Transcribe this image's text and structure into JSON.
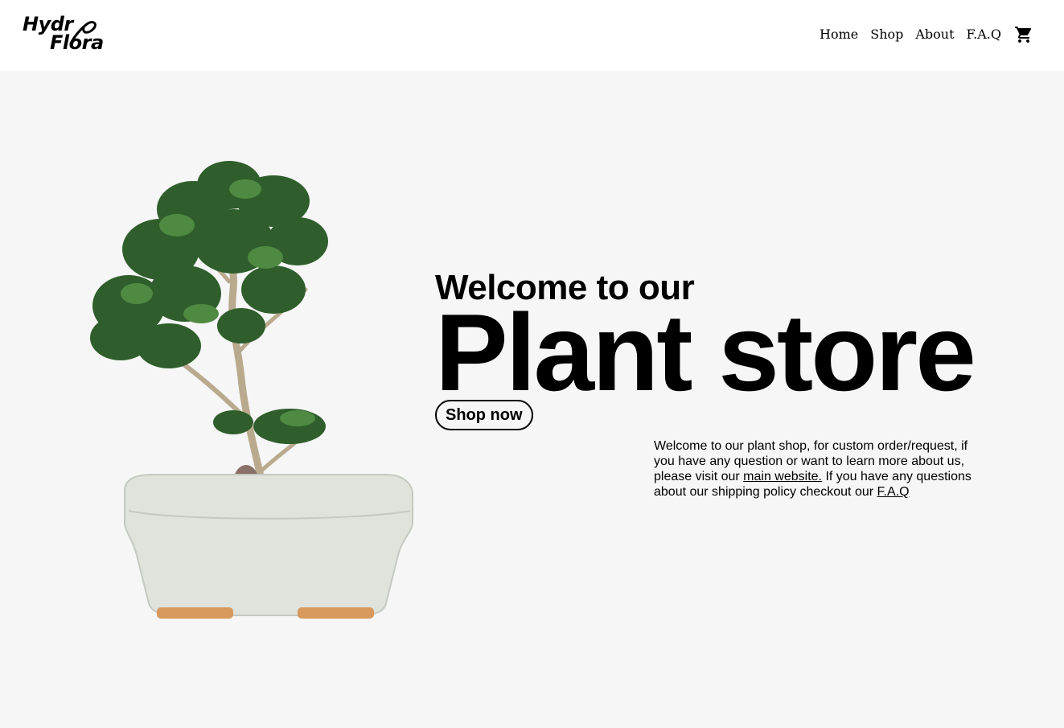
{
  "brand": {
    "line1": "Hydr",
    "line2": "Flora"
  },
  "nav": {
    "items": [
      "Home",
      "Shop",
      "About",
      "F.A.Q"
    ],
    "cart_icon": "shopping-cart-icon"
  },
  "hero": {
    "welcome": "Welcome to our",
    "title": "Plant store",
    "cta_label": "Shop now"
  },
  "description": {
    "part1": "Welcome to our plant shop, for custom order/request, if you have any question or want to learn more about us, please visit our ",
    "link1": "main website.",
    "part2": " If you have any questions about our shipping policy checkout our ",
    "link2": "F.A.Q"
  },
  "colors": {
    "header_bg": "#ffffff",
    "page_bg": "#f6f6f6",
    "text": "#000000",
    "foliage": "#2f5e2c",
    "pot": "#dfe3dc"
  }
}
